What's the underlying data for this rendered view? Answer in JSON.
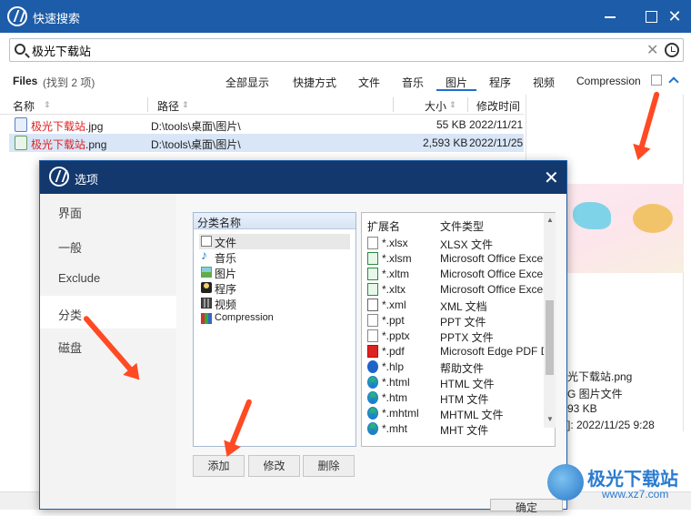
{
  "app": {
    "title": "快速搜索"
  },
  "search": {
    "value": "极光下载站"
  },
  "files": {
    "label": "Files",
    "count": "(找到 2 项)",
    "tabs": [
      "全部显示",
      "快捷方式",
      "文件",
      "音乐",
      "图片",
      "程序",
      "视频",
      "Compression"
    ],
    "active_tab": "图片"
  },
  "columns": {
    "name": "名称",
    "path": "路径",
    "size": "大小",
    "modified": "修改时间"
  },
  "rows": [
    {
      "name": "极光下载站",
      "ext": ".jpg",
      "path": "D:\\tools\\桌面\\图片\\",
      "size": "55 KB",
      "modified": "2022/11/21"
    },
    {
      "name": "极光下载站",
      "ext": ".png",
      "path": "D:\\tools\\桌面\\图片\\",
      "size": "2,593 KB",
      "modified": "2022/11/25"
    }
  ],
  "preview": {
    "filename": "光下载站.png",
    "type": "G 图片文件",
    "size": "93 KB",
    "modified": "]: 2022/11/25 9:28"
  },
  "dialog": {
    "title": "选项",
    "nav": [
      "界面",
      "一般",
      "Exclude",
      "分类",
      "磁盘"
    ],
    "active_nav": "分类",
    "category_header": "分类名称",
    "categories": [
      {
        "label": "文件",
        "icon": "document-icon"
      },
      {
        "label": "音乐",
        "icon": "music-icon"
      },
      {
        "label": "图片",
        "icon": "picture-icon"
      },
      {
        "label": "程序",
        "icon": "program-icon"
      },
      {
        "label": "视频",
        "icon": "video-icon"
      },
      {
        "label": "Compression",
        "icon": "archive-icon"
      }
    ],
    "ext_header": {
      "ext": "扩展名",
      "type": "文件类型"
    },
    "extensions": [
      {
        "ext": "*.xlsx",
        "type": "XLSX 文件",
        "icon": "doc"
      },
      {
        "ext": "*.xlsm",
        "type": "Microsoft Office Excel ?",
        "icon": "xl"
      },
      {
        "ext": "*.xltm",
        "type": "Microsoft Office Excel ?",
        "icon": "xl"
      },
      {
        "ext": "*.xltx",
        "type": "Microsoft Office Excel ?",
        "icon": "xl"
      },
      {
        "ext": "*.xml",
        "type": "XML 文档",
        "icon": "xml"
      },
      {
        "ext": "*.ppt",
        "type": "PPT 文件",
        "icon": "doc"
      },
      {
        "ext": "*.pptx",
        "type": "PPTX 文件",
        "icon": "doc"
      },
      {
        "ext": "*.pdf",
        "type": "Microsoft Edge PDF Do",
        "icon": "pdf"
      },
      {
        "ext": "*.hlp",
        "type": "帮助文件",
        "icon": "hlp"
      },
      {
        "ext": "*.html",
        "type": "HTML 文件",
        "icon": "edge"
      },
      {
        "ext": "*.htm",
        "type": "HTM 文件",
        "icon": "edge"
      },
      {
        "ext": "*.mhtml",
        "type": "MHTML 文件",
        "icon": "edge"
      },
      {
        "ext": "*.mht",
        "type": "MHT 文件",
        "icon": "edge"
      }
    ],
    "buttons": {
      "add": "添加",
      "modify": "修改",
      "delete": "删除",
      "ok": "确定"
    }
  },
  "watermark": {
    "text": "极光下载站",
    "url": "www.xz7.com"
  },
  "colors": {
    "titlebar": "#1d5ca8",
    "dialog_titlebar": "#12386e",
    "arrow": "#ff4a24",
    "filename_red": "#e02020"
  }
}
